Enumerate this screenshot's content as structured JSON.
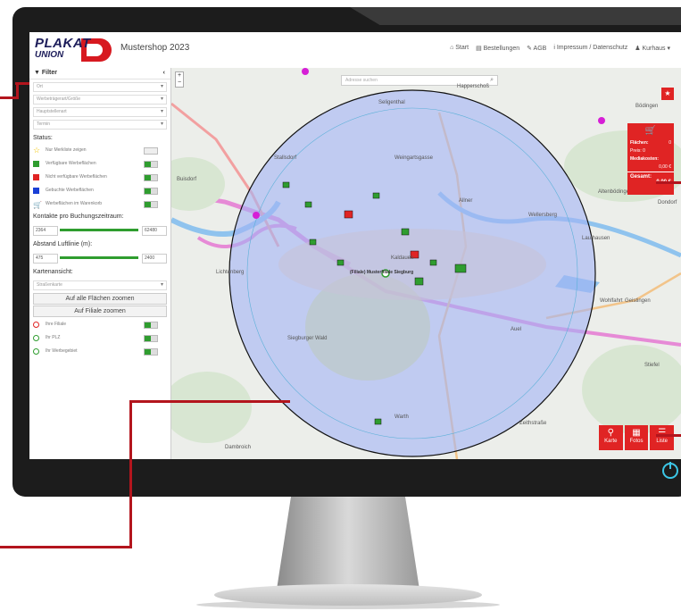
{
  "app": {
    "logo_main": "PLAKAT",
    "logo_sub": "UNION",
    "shop_name": "Mustershop 2023"
  },
  "nav": {
    "items": [
      "Start",
      "Bestellungen",
      "AGB",
      "Impressum / Datenschutz",
      "Kurhaus"
    ]
  },
  "sidebar": {
    "filter_title": "Filter",
    "selects": [
      "Ort",
      "Werbeträgerart/Größe",
      "Hauptstellenart",
      "Termin"
    ],
    "status_title": "Status:",
    "status_rows": [
      {
        "label": "Nur Merkliste zeigen",
        "color": "#f2c400",
        "icon": "star-icon"
      },
      {
        "label": "Verfügbare Werbeflächen",
        "color": "#2f9d2f"
      },
      {
        "label": "Nicht verfügbare Werbeflächen",
        "color": "#e02424"
      },
      {
        "label": "Gebuchte Werbeflächen",
        "color": "#1a3fd6"
      },
      {
        "label": "Werbeflächen im Warenkorb",
        "color": "#f2c400",
        "icon": "cart-icon"
      }
    ],
    "contacts_title": "Kontakte pro Buchungszeitraum:",
    "contacts_min": "2364",
    "contacts_max": "62480",
    "distance_title": "Abstand Luftlinie (m):",
    "distance_min": "475",
    "distance_max": "2400",
    "map_view_title": "Kartenansicht:",
    "map_view_select": "Straßenkarte",
    "zoom_all": "Auf alle Flächen zoomen",
    "zoom_branch": "Auf Filiale zoomen",
    "layers": [
      "Ihre Filiale",
      "Ihr PLZ",
      "Ihr Werbegebiet"
    ]
  },
  "map": {
    "search_placeholder": "Adresse suchen",
    "labels": [
      "Seligenthal",
      "Happerschoß",
      "Stallsdorf",
      "Weingartsgasse",
      "Allner",
      "Wellersberg",
      "Lauthausen",
      "Geistingen",
      "Dondorf",
      "Altenbödingen",
      "Buisdorf",
      "Siegburger Wald",
      "Kaldauen",
      "Zeithstraße",
      "Dambroich",
      "Stiefel",
      "Wohlfahrt",
      "Warth",
      "Auel",
      "Bödingen",
      "Lichtenberg"
    ],
    "center_label": "(Filiale) Musterfiliale Siegburg"
  },
  "cart": {
    "flaechen_label": "Flächen:",
    "flaechen_value": "0",
    "preis_label": "Preis: 0",
    "media_label": "Mediakosten:",
    "media_value": "0,00 €",
    "total_label": "Gesamt:",
    "total_value": "0,00 €"
  },
  "views": {
    "karte": "Karte",
    "fotos": "Fotos",
    "liste": "Liste"
  },
  "colors": {
    "accent": "#e02424",
    "available": "#2f9d2f",
    "unavailable": "#e02424",
    "radius_fill": "#a4b4f5"
  }
}
